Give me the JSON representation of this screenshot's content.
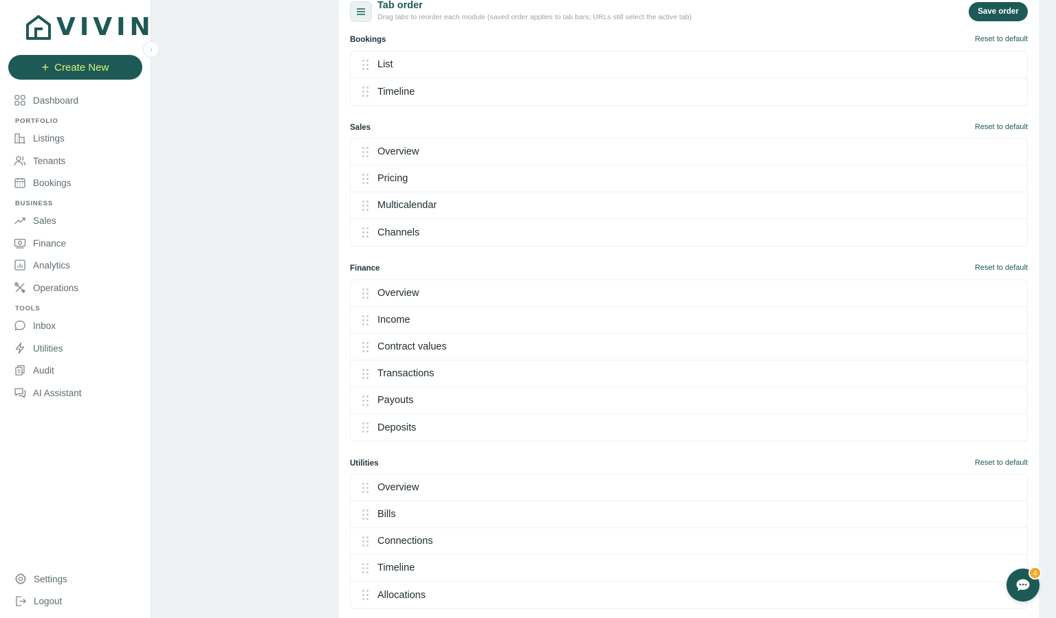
{
  "brand": {
    "name": "VIVIN"
  },
  "sidebar": {
    "create_label": "Create New",
    "dashboard": "Dashboard",
    "sections": {
      "portfolio": "PORTFOLIO",
      "business": "BUSINESS",
      "tools": "TOOLS"
    },
    "portfolio_items": [
      "Listings",
      "Tenants",
      "Bookings"
    ],
    "business_items": [
      "Sales",
      "Finance",
      "Analytics",
      "Operations"
    ],
    "tools_items": [
      "Inbox",
      "Utilities",
      "Audit",
      "AI Assistant"
    ],
    "settings": "Settings",
    "logout": "Logout"
  },
  "page": {
    "title": "Tab order",
    "subtitle": "Drag tabs to reorder each module (saved order applies to tab bars; URLs still select the active tab)",
    "save_label": "Save order",
    "reset_label": "Reset to default"
  },
  "modules": {
    "bookings": {
      "name": "Bookings",
      "tabs": [
        "List",
        "Timeline"
      ]
    },
    "sales": {
      "name": "Sales",
      "tabs": [
        "Overview",
        "Pricing",
        "Multicalendar",
        "Channels"
      ]
    },
    "finance": {
      "name": "Finance",
      "tabs": [
        "Overview",
        "Income",
        "Contract values",
        "Transactions",
        "Payouts",
        "Deposits"
      ]
    },
    "utilities": {
      "name": "Utilities",
      "tabs": [
        "Overview",
        "Bills",
        "Connections",
        "Timeline",
        "Allocations"
      ]
    }
  },
  "chat": {
    "unread_count": "4"
  },
  "colors": {
    "brand": "#1d5a56",
    "accent": "#d9f07a",
    "badge": "#f5a623"
  }
}
